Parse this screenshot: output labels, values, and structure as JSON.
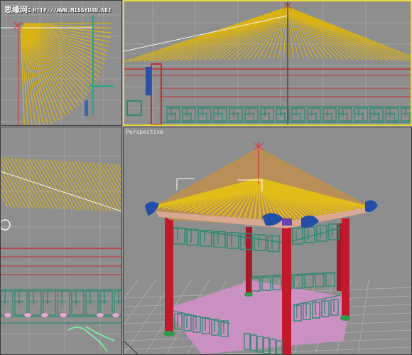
{
  "watermark": {
    "site_name": "思缘网:",
    "url": "HTTP://WWW.MISSYUAN.NET"
  },
  "viewports": {
    "top": {
      "label": ""
    },
    "front": {
      "label": ""
    },
    "left": {
      "label": ""
    },
    "perspective": {
      "label": "Perspective"
    }
  },
  "colors": {
    "grid": "#9c9c9c",
    "roof_wire": "#d9b316",
    "pillar": "#c2182b",
    "lattice": "#2e8a72",
    "selection_border": "#e9d93a",
    "floor": "#d08ec7"
  }
}
